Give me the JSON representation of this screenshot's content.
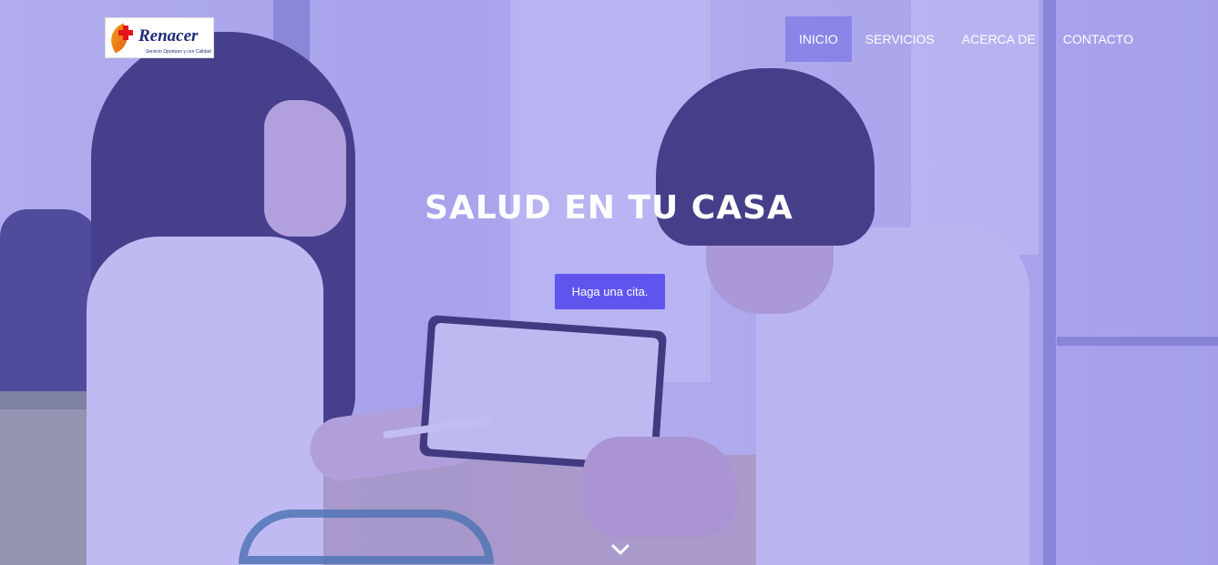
{
  "brand": {
    "logo_text": "Renacer",
    "logo_tagline": "Servicio Oportuno y con Calidad"
  },
  "nav": {
    "items": [
      {
        "label": "INICIO",
        "active": true
      },
      {
        "label": "SERVICIOS",
        "active": false
      },
      {
        "label": "ACERCA DE",
        "active": false
      },
      {
        "label": "CONTACTO",
        "active": false
      }
    ]
  },
  "hero": {
    "title": "SALUD EN TU CASA",
    "cta_label": "Haga una cita."
  },
  "colors": {
    "overlay": "#7066e6",
    "cta": "#5f55ee",
    "nav_active": "#6e67e2"
  },
  "icons": {
    "scroll": "chevron-down-icon"
  }
}
